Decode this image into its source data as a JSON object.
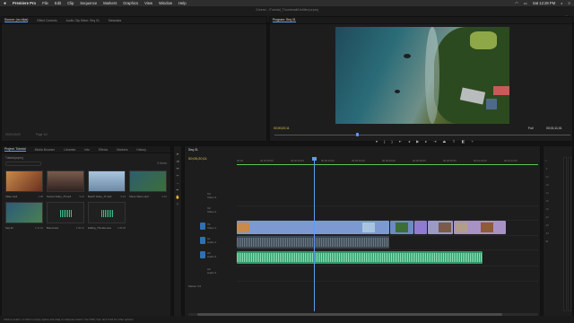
{
  "menubar": {
    "apple": "",
    "app": "Premiere Pro",
    "items": [
      "File",
      "Edit",
      "Clip",
      "Sequence",
      "Markers",
      "Graphics",
      "View",
      "Window",
      "Help"
    ],
    "clock": "Sat 12:28 PM"
  },
  "titlebar": {
    "title": "/Users/.../Tutorial_Thumbnail/Untitled.prproj"
  },
  "workspaces": {
    "items": [
      "Learning",
      "Assembly",
      "Editing",
      "Color",
      "Effects",
      "Audio",
      "Graphics",
      "Libraries"
    ],
    "active": "Editing"
  },
  "source": {
    "tabs": [
      "Source: (no clips)",
      "Effect Controls",
      "Audio Clip Mixer: Seq 01",
      "Metadata"
    ],
    "timecode": "00;00;00;00",
    "fit": "Page 1/2"
  },
  "program": {
    "tab": "Program: Seq 01",
    "timecode_left": "00;00;20;11",
    "fit": "Full",
    "timecode_right": "00;01;11;01"
  },
  "project": {
    "tabs": [
      "Project: Tutorial",
      "Media Browser",
      "Libraries",
      "Info",
      "Effects",
      "Markers",
      "History"
    ],
    "path": "Tutorial.prproj",
    "count": "6 Items",
    "items": [
      {
        "name": "Video.mp4",
        "dur": "1:28",
        "kind": "video",
        "color": "#b0634a"
      },
      {
        "name": "Sunset Video_JT.mp4",
        "dur": "9:21",
        "kind": "video",
        "color": "#6b4f47"
      },
      {
        "name": "Beach Video_JT.mp4",
        "dur": "5:23",
        "kind": "video",
        "color": "#8aa8c8"
      },
      {
        "name": "Shore Video.mp4",
        "dur": "4:10",
        "kind": "video",
        "color": "#3c6a7a"
      },
      {
        "name": "Seq 01",
        "dur": "1:11:01",
        "kind": "video",
        "color": "#2f6d8a"
      },
      {
        "name": "Brand.wav",
        "dur": "1:09:12",
        "kind": "audio",
        "color": "#202020"
      },
      {
        "name": "Editing_Thunder.wav",
        "dur": "1:05:48",
        "kind": "audio",
        "color": "#202020"
      }
    ]
  },
  "timeline": {
    "seq_tab": "Seq 01",
    "timecode": "00;00;20;11",
    "ruler": [
      "00;00",
      "00;00;08;00",
      "00;00;16;00",
      "00;00;24;00",
      "00;00;32;00",
      "00;00;40;00",
      "00;00;48;00",
      "00;00;56;00",
      "00;01;04;00",
      "00;01;12;00"
    ],
    "tracks": [
      {
        "label": "V3",
        "name": "Video 3"
      },
      {
        "label": "V2",
        "name": "Video 2"
      },
      {
        "label": "V1",
        "name": "Video 1"
      },
      {
        "label": "A1",
        "name": "Audio 1"
      },
      {
        "label": "A2",
        "name": "Audio 2"
      },
      {
        "label": "A3",
        "name": "Audio 3"
      }
    ],
    "master": "Master  0.0"
  },
  "meters": {
    "scale": [
      "0",
      "-6",
      "-12",
      "-18",
      "-24",
      "-30",
      "-36",
      "-42",
      "-48",
      "-54",
      "dB"
    ]
  },
  "statusbar": {
    "text": "Click to select, or click in empty space and drag to marquee select. Use Shift, Opt, and Cmd for other options."
  }
}
